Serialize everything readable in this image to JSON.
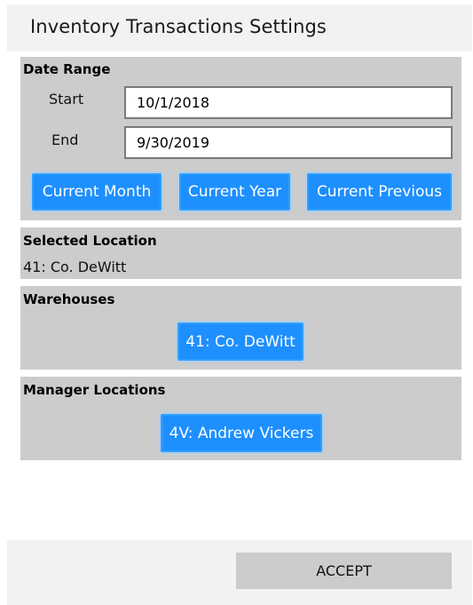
{
  "window": {
    "title": "Inventory Transactions Settings"
  },
  "date_range": {
    "header": "Date Range",
    "start_label": "Start",
    "start_value": "10/1/2018",
    "end_label": "End",
    "end_value": "9/30/2019",
    "buttons": {
      "current_month": "Current Month",
      "current_year": "Current Year",
      "current_previous": "Current Previous"
    }
  },
  "selected_location": {
    "header": "Selected Location",
    "value": "41: Co. DeWitt"
  },
  "warehouses": {
    "header": "Warehouses",
    "items": [
      "41: Co. DeWitt"
    ]
  },
  "manager_locations": {
    "header": "Manager Locations",
    "items": [
      "4V: Andrew Vickers"
    ]
  },
  "footer": {
    "accept_label": "ACCEPT"
  },
  "colors": {
    "accent": "#1e8fff",
    "panel": "#cccccc",
    "chrome": "#f2f2f2"
  }
}
